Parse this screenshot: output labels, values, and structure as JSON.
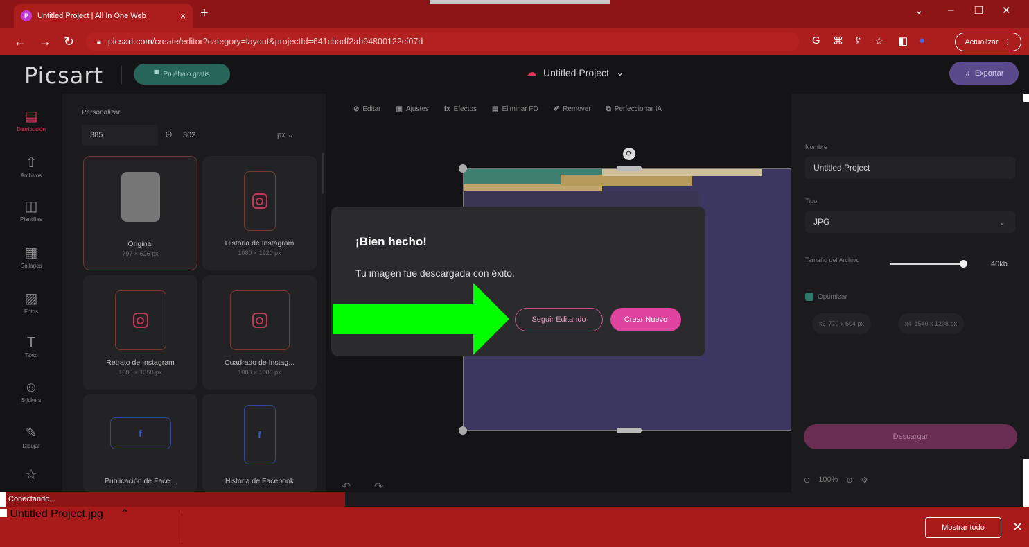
{
  "browser": {
    "tab_title": "Untitled Project | All In One Web",
    "tab_close": "×",
    "new_tab": "+",
    "url_host": "picsart.com",
    "url_path": "/create/editor?category=layout&projectId=641cbadf2ab94800122cf07d",
    "update_label": "Actualizar"
  },
  "app": {
    "logo": "Picsart",
    "trial_label": "Pruébalo gratis",
    "project_name": "Untitled Project",
    "export_label": "Exportar"
  },
  "rail": [
    {
      "label": "Distribución",
      "icon": "▤"
    },
    {
      "label": "Archivos",
      "icon": "⇧"
    },
    {
      "label": "Plantillas",
      "icon": "◫"
    },
    {
      "label": "Collages",
      "icon": "▦"
    },
    {
      "label": "Fotos",
      "icon": "▨"
    },
    {
      "label": "Texto",
      "icon": "T"
    },
    {
      "label": "Stickers",
      "icon": "☺"
    },
    {
      "label": "Dibujar",
      "icon": "✎"
    },
    {
      "label": "",
      "icon": "☆"
    }
  ],
  "layout_panel": {
    "heading": "Personalizar",
    "width": "385",
    "height": "302",
    "unit": "px",
    "cards": [
      {
        "name": "Original",
        "size": "797 × 626 px"
      },
      {
        "name": "Historia de Instagram",
        "size": "1080 × 1920 px"
      },
      {
        "name": "Retrato de Instagram",
        "size": "1080 × 1350 px"
      },
      {
        "name": "Cuadrado de Instag...",
        "size": "1080 × 1080 px"
      },
      {
        "name": "Publicación de Face...",
        "size": ""
      },
      {
        "name": "Historia de Facebook",
        "size": ""
      }
    ]
  },
  "tools": [
    "Editar",
    "Ajustes",
    "Efectos",
    "Eliminar FD",
    "Remover",
    "Perfeccionar IA"
  ],
  "right_panel": {
    "name_label": "Nombre",
    "name_value": "Untitled Project",
    "type_label": "Tipo",
    "type_value": "JPG",
    "size_label": "Tamaño del Archivo",
    "size_value": "40kb",
    "optimize_label": "Optimizar",
    "chip1": "770 x 604 px",
    "chip2": "1540 x 1208 px",
    "download_label": "Descargar",
    "zoom": "100%"
  },
  "modal": {
    "title": "¡Bien hecho!",
    "message": "Tu imagen fue descargada con éxito.",
    "keep_editing": "Seguir Editando",
    "create_new": "Crear Nuevo"
  },
  "status_text": "Conectando...",
  "shelf": {
    "file_name": "Untitled Project.jpg",
    "show_all": "Mostrar todo"
  },
  "colors": {
    "chrome": "#ac1d1d",
    "accent_pink": "#e0429f",
    "arrow_green": "#00ff00"
  }
}
